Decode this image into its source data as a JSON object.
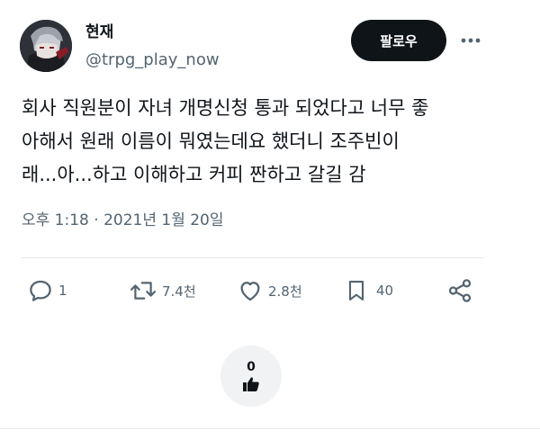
{
  "author": {
    "display_name": "현재",
    "handle": "@trpg_play_now",
    "avatar_icon": "anime-avatar"
  },
  "header": {
    "follow_label": "팔로우",
    "more_icon": "more-horizontal-icon"
  },
  "tweet": {
    "lines": [
      "회사 직원분이 자녀 개명신청 통과 되었다고 너무 좋",
      "아해서 원래 이름이 뭐였는데요 했더니 조주빈이",
      "래...아...하고 이해하고 커피 짠하고 갈길 감"
    ],
    "timestamp": "오후 1:18 · 2021년 1월 20일"
  },
  "actions": {
    "reply_count": "1",
    "retweet_count": "7.4천",
    "like_count": "2.8천",
    "bookmark_count": "40"
  },
  "reaction": {
    "count": "0"
  },
  "colors": {
    "text": "#0f1419",
    "secondary": "#536471",
    "button_bg": "#0f1419",
    "divider": "#e7eaec",
    "reaction_bg": "#f1f2f3"
  }
}
